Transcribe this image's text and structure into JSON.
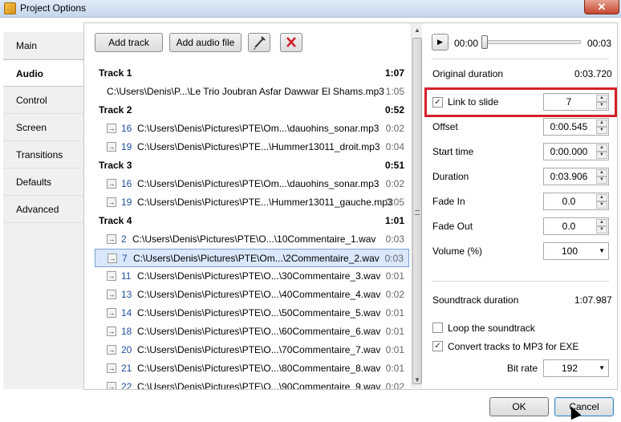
{
  "window": {
    "title": "Project Options",
    "close_glyph": "✕"
  },
  "tabs": [
    {
      "label": "Main"
    },
    {
      "label": "Audio"
    },
    {
      "label": "Control"
    },
    {
      "label": "Screen"
    },
    {
      "label": "Transitions"
    },
    {
      "label": "Defaults"
    },
    {
      "label": "Advanced"
    }
  ],
  "toolbar": {
    "add_track": "Add track",
    "add_audio_file": "Add audio file",
    "edit_icon": "pencil-icon",
    "delete_icon": "delete-x-icon"
  },
  "tracks": [
    {
      "name": "Track 1",
      "duration": "1:07",
      "files": [
        {
          "number": "",
          "path": "C:\\Users\\Denis\\P...\\Le Trio Joubran Asfar Dawwar El Shams.mp3",
          "duration": "1:05"
        }
      ]
    },
    {
      "name": "Track 2",
      "duration": "0:52",
      "files": [
        {
          "number": "16",
          "path": "C:\\Users\\Denis\\Pictures\\PTE\\Om...\\dauohins_sonar.mp3",
          "duration": "0:02"
        },
        {
          "number": "19",
          "path": "C:\\Users\\Denis\\Pictures\\PTE...\\Hummer13011_droit.mp3",
          "duration": "0:04"
        }
      ]
    },
    {
      "name": "Track 3",
      "duration": "0:51",
      "files": [
        {
          "number": "16",
          "path": "C:\\Users\\Denis\\Pictures\\PTE\\Om...\\dauohins_sonar.mp3",
          "duration": "0:02"
        },
        {
          "number": "19",
          "path": "C:\\Users\\Denis\\Pictures\\PTE...\\Hummer13011_gauche.mp3",
          "duration": "0:05"
        }
      ]
    },
    {
      "name": "Track 4",
      "duration": "1:01",
      "files": [
        {
          "number": "2",
          "path": "C:\\Users\\Denis\\Pictures\\PTE\\O...\\10Commentaire_1.wav",
          "duration": "0:03"
        },
        {
          "number": "7",
          "path": "C:\\Users\\Denis\\Pictures\\PTE\\Om...\\2Commentaire_2.wav",
          "duration": "0:03"
        },
        {
          "number": "11",
          "path": "C:\\Users\\Denis\\Pictures\\PTE\\O...\\30Commentaire_3.wav",
          "duration": "0:01"
        },
        {
          "number": "13",
          "path": "C:\\Users\\Denis\\Pictures\\PTE\\O...\\40Commentaire_4.wav",
          "duration": "0:02"
        },
        {
          "number": "14",
          "path": "C:\\Users\\Denis\\Pictures\\PTE\\O...\\50Commentaire_5.wav",
          "duration": "0:01"
        },
        {
          "number": "18",
          "path": "C:\\Users\\Denis\\Pictures\\PTE\\O...\\60Commentaire_6.wav",
          "duration": "0:01"
        },
        {
          "number": "20",
          "path": "C:\\Users\\Denis\\Pictures\\PTE\\O...\\70Commentaire_7.wav",
          "duration": "0:01"
        },
        {
          "number": "21",
          "path": "C:\\Users\\Denis\\Pictures\\PTE\\O...\\80Commentaire_8.wav",
          "duration": "0:01"
        },
        {
          "number": "22",
          "path": "C:\\Users\\Denis\\Pictures\\PTE\\O...\\90Commentaire_9.wav",
          "duration": "0:02"
        }
      ]
    }
  ],
  "player": {
    "current": "00:00",
    "end": "00:03",
    "play_icon": "play-icon"
  },
  "props": {
    "original_duration_label": "Original duration",
    "original_duration_value": "0:03.720",
    "link_label": "Link to slide",
    "link_checked": "✓",
    "link_value": "7",
    "offset_label": "Offset",
    "offset_value": "0:00.545",
    "start_label": "Start time",
    "start_value": "0:00.000",
    "duration_label": "Duration",
    "duration_value": "0:03.906",
    "fade_in_label": "Fade In",
    "fade_in_value": "0.0",
    "fade_out_label": "Fade Out",
    "fade_out_value": "0.0",
    "volume_label": "Volume (%)",
    "volume_value": "100",
    "soundtrack_label": "Soundtrack duration",
    "soundtrack_value": "1:07.987",
    "loop_label": "Loop the soundtrack",
    "loop_checked": "",
    "convert_label": "Convert tracks to MP3 for EXE",
    "convert_checked": "✓",
    "bitrate_label": "Bit rate",
    "bitrate_value": "192"
  },
  "footer": {
    "ok": "OK",
    "cancel": "Cancel"
  }
}
